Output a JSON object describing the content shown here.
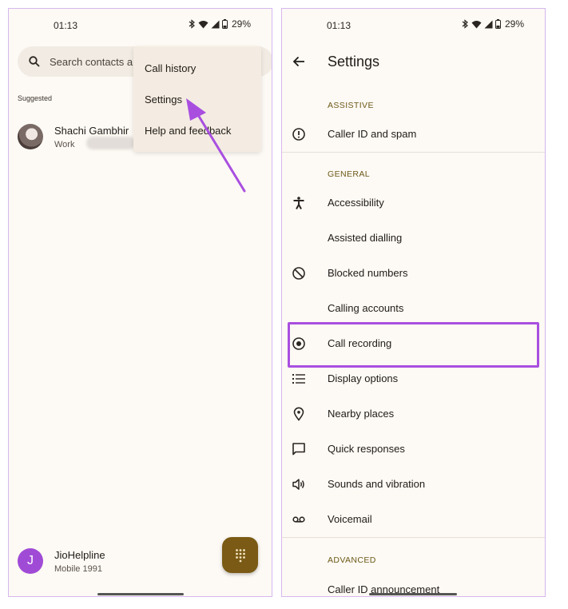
{
  "status_bar": {
    "time": "01:13",
    "battery": "29%"
  },
  "left_screen": {
    "search_placeholder": "Search contacts a",
    "section_label": "Suggested",
    "contact": {
      "name": "Shachi Gambhir",
      "label": "Work"
    },
    "menu": {
      "items": [
        "Call history",
        "Settings",
        "Help and feedback"
      ]
    },
    "bottom_contact": {
      "initial": "J",
      "name": "JioHelpline",
      "detail": "Mobile 1991"
    }
  },
  "right_screen": {
    "title": "Settings",
    "sections": {
      "assistive": "ASSISTIVE",
      "general": "GENERAL",
      "advanced": "ADVANCED"
    },
    "items": {
      "caller_id_spam": "Caller ID and spam",
      "accessibility": "Accessibility",
      "assisted_dialling": "Assisted dialling",
      "blocked_numbers": "Blocked numbers",
      "calling_accounts": "Calling accounts",
      "call_recording": "Call recording",
      "display_options": "Display options",
      "nearby_places": "Nearby places",
      "quick_responses": "Quick responses",
      "sounds_vibration": "Sounds and vibration",
      "voicemail": "Voicemail",
      "caller_id_announcement": "Caller ID announcement"
    }
  },
  "colors": {
    "annotation": "#a94fe0",
    "accent": "#7a5a14",
    "section_header": "#6c5a18"
  }
}
